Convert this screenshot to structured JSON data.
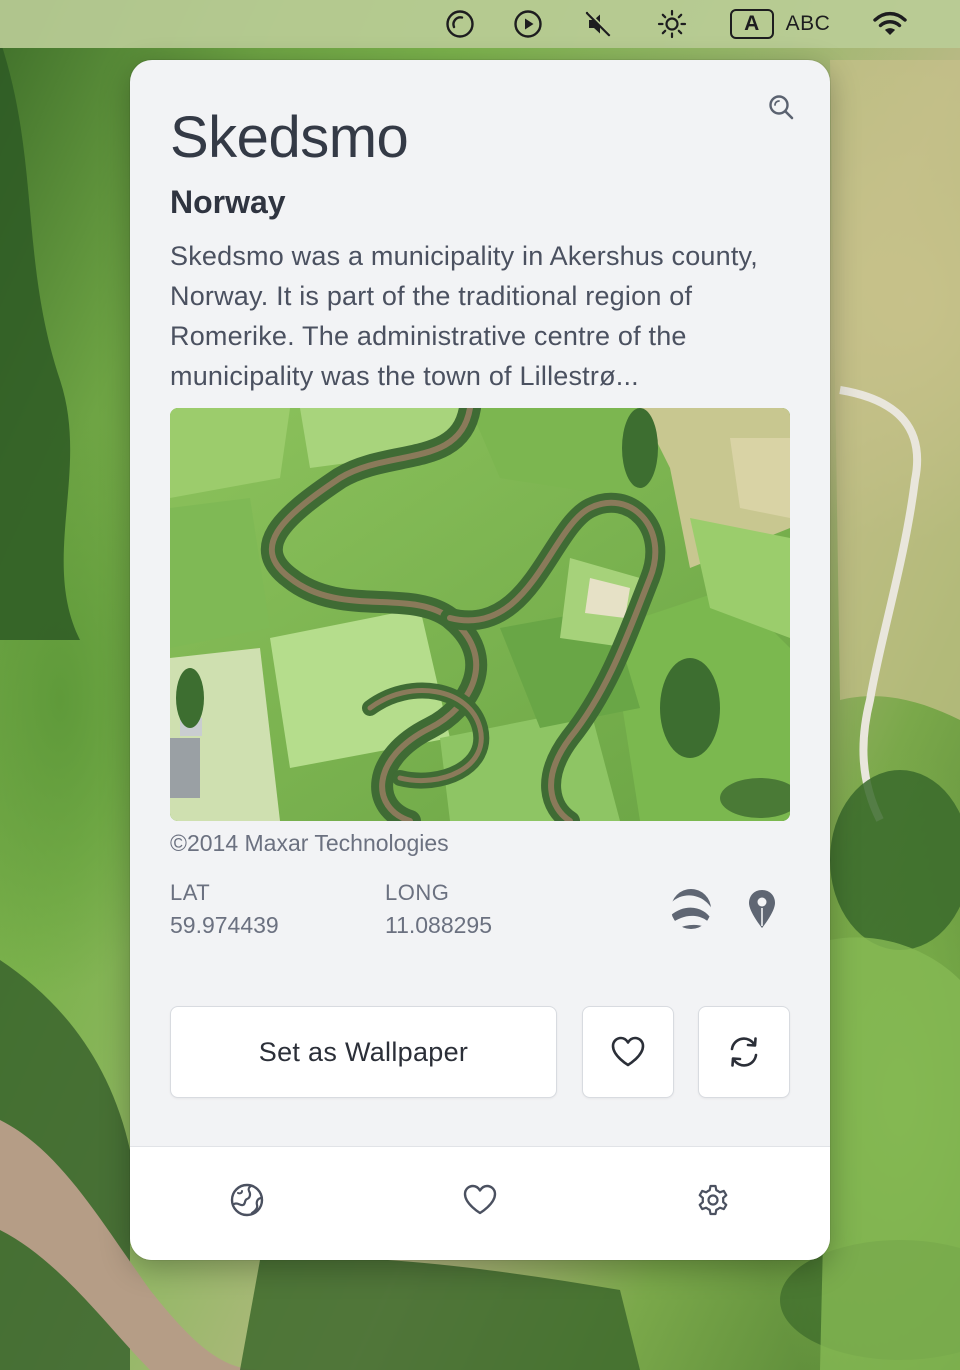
{
  "menubar": {
    "items": [
      {
        "icon": "sync-circle-icon"
      },
      {
        "icon": "play-circle-icon"
      },
      {
        "icon": "speaker-muted-icon"
      },
      {
        "icon": "brightness-icon"
      },
      {
        "icon": "input-source-icon",
        "glyph": "A",
        "label": "ABC"
      },
      {
        "icon": "wifi-icon"
      }
    ]
  },
  "panel": {
    "title": "Skedsmo",
    "country": "Norway",
    "description": "Skedsmo was a municipality in Akershus county, Norway. It is part of the traditional region of Romerike. The administrative centre of the municipality was the town of Lillestrø...",
    "image_credit": "©2014 Maxar Technologies",
    "coordinates": {
      "lat_label": "LAT",
      "lat_value": "59.974439",
      "long_label": "LONG",
      "long_value": "11.088295"
    },
    "actions": {
      "set_wallpaper_label": "Set as Wallpaper"
    }
  },
  "icons": {
    "search": "search-icon",
    "google_earth": "google-earth-icon",
    "map_pin": "map-pin-icon",
    "favorite": "heart-icon",
    "refresh": "refresh-icon",
    "explore": "globe-icon",
    "settings": "gear-icon"
  },
  "colors": {
    "panel_bg": "#f2f3f5",
    "title_text": "#343a46",
    "muted_text": "#6b7180",
    "icon_gray": "#6b7280",
    "menubar_bg": "#bacc96"
  }
}
